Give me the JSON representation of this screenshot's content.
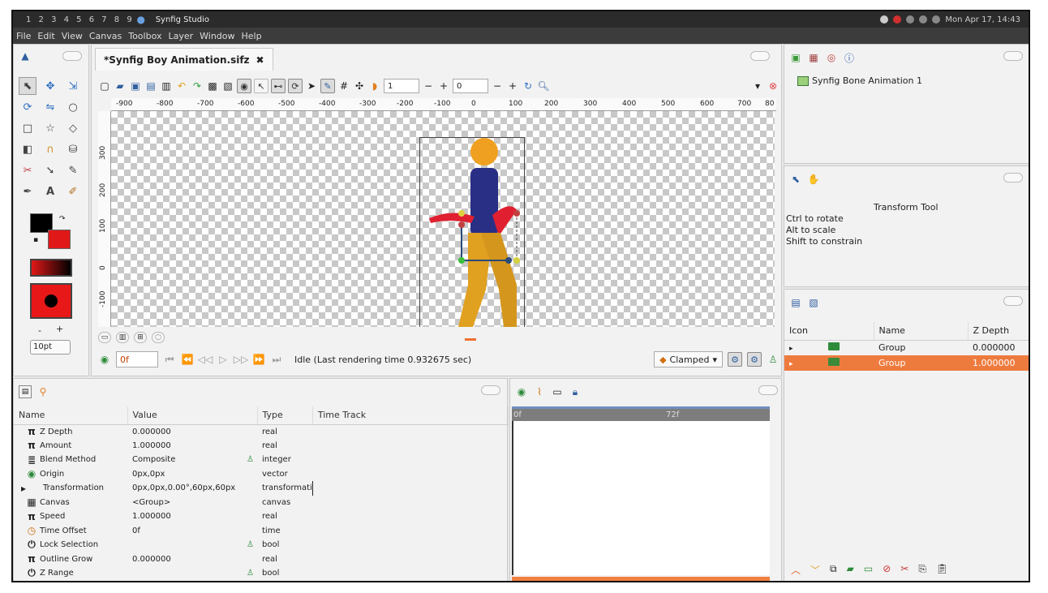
{
  "system": {
    "workspaces": "1 2 3 4 5 6 7 8 9",
    "app_title": "Synfig Studio",
    "clock": "Mon Apr 17, 14:43"
  },
  "menu": [
    "File",
    "Edit",
    "View",
    "Canvas",
    "Toolbox",
    "Layer",
    "Window",
    "Help"
  ],
  "document": {
    "tab_title": "*Synfig Boy Animation.sifz",
    "toolbar": {
      "frame_a": "1",
      "frame_b": "0"
    },
    "ruler_top": [
      "-900",
      "-800",
      "-700",
      "-600",
      "-500",
      "-400",
      "-300",
      "-200",
      "-100",
      "0",
      "100",
      "200",
      "300",
      "400",
      "500",
      "600",
      "700",
      "80"
    ],
    "ruler_left": [
      "300",
      "200",
      "100",
      "0",
      "-100"
    ]
  },
  "toolbox": {
    "brush_size": "10pt",
    "minus": "-",
    "plus": "+",
    "fill_color": "#e01818",
    "outline_color": "#000000"
  },
  "timebar": {
    "current_frame": "0f",
    "status": "Idle (Last rendering time 0.932675 sec)",
    "interpolation": "Clamped"
  },
  "canvas_browser": {
    "item": "Synfig Bone Animation 1"
  },
  "tool_options": {
    "title": "Transform Tool",
    "lines": [
      "Ctrl to rotate",
      "Alt to scale",
      "Shift to constrain"
    ]
  },
  "layers": {
    "headers": [
      "Icon",
      "Name",
      "Z Depth"
    ],
    "rows": [
      {
        "name": "Group",
        "zdepth": "0.000000",
        "selected": false
      },
      {
        "name": "Group",
        "zdepth": "1.000000",
        "selected": true
      }
    ]
  },
  "params": {
    "headers": [
      "Name",
      "Value",
      "Type",
      "Time Track"
    ],
    "rows": [
      {
        "icon": "π",
        "name": "Z Depth",
        "value": "0.000000",
        "type": "real"
      },
      {
        "icon": "π",
        "name": "Amount",
        "value": "1.000000",
        "type": "real"
      },
      {
        "icon": "≣",
        "name": "Blend Method",
        "value": "Composite",
        "type": "integer"
      },
      {
        "icon": "◉",
        "name": "Origin",
        "value": "0px,0px",
        "type": "vector"
      },
      {
        "icon": "▸",
        "name": "Transformation",
        "value": "0px,0px,0.00°,60px,60px",
        "type": "transformati"
      },
      {
        "icon": "▦",
        "name": "Canvas",
        "value": "<Group>",
        "type": "canvas"
      },
      {
        "icon": "π",
        "name": "Speed",
        "value": "1.000000",
        "type": "real"
      },
      {
        "icon": "◷",
        "name": "Time Offset",
        "value": "0f",
        "type": "time"
      },
      {
        "icon": "⏻",
        "name": "Lock Selection",
        "value": "",
        "type": "bool"
      },
      {
        "icon": "π",
        "name": "Outline Grow",
        "value": "0.000000",
        "type": "real"
      },
      {
        "icon": "⏻",
        "name": "Z Range",
        "value": "",
        "type": "bool"
      }
    ]
  },
  "timetrack": {
    "start": "0f",
    "end": "72f"
  }
}
